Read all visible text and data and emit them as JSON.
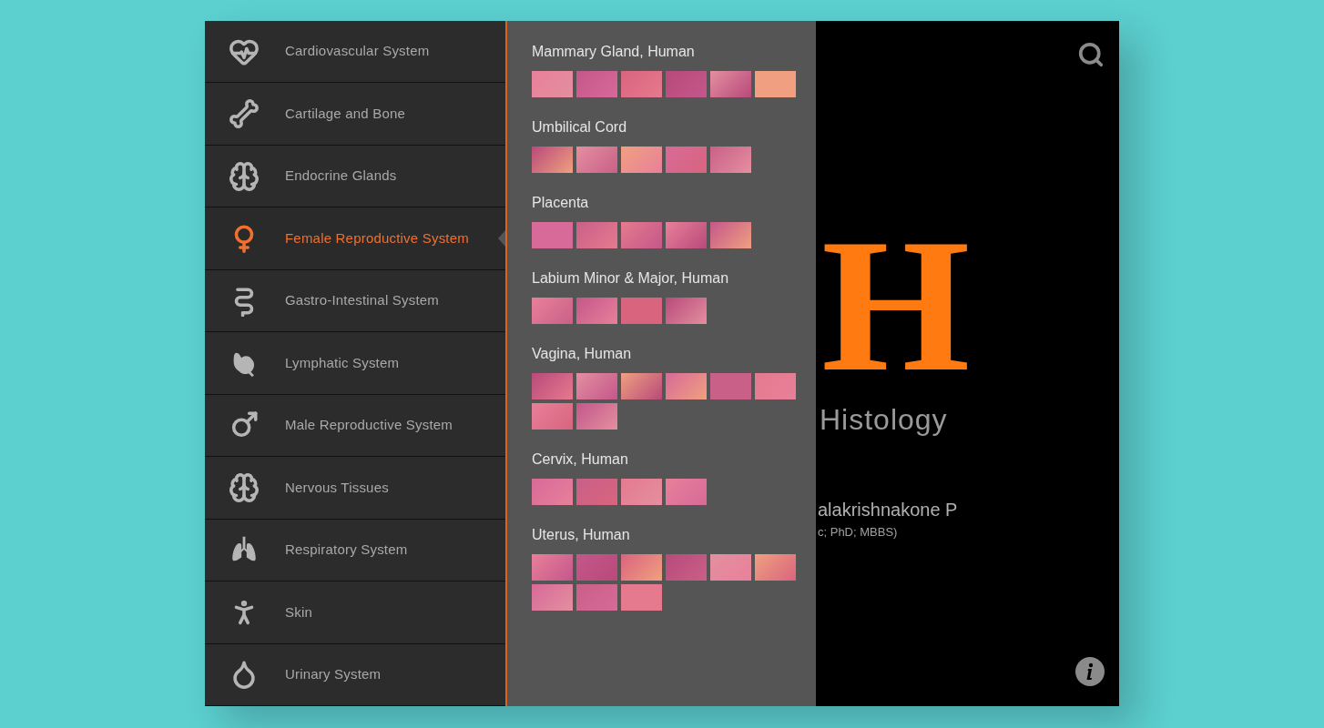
{
  "sidebar": {
    "items": [
      {
        "label": "Cardiovascular System",
        "selected": false
      },
      {
        "label": "Cartilage and Bone",
        "selected": false
      },
      {
        "label": "Endocrine Glands",
        "selected": false
      },
      {
        "label": "Female Reproductive System",
        "selected": true
      },
      {
        "label": "Gastro-Intestinal System",
        "selected": false
      },
      {
        "label": "Lymphatic System",
        "selected": false
      },
      {
        "label": "Male Reproductive System",
        "selected": false
      },
      {
        "label": "Nervous Tissues",
        "selected": false
      },
      {
        "label": "Respiratory System",
        "selected": false
      },
      {
        "label": "Skin",
        "selected": false
      },
      {
        "label": "Urinary System",
        "selected": false
      }
    ]
  },
  "specimens": [
    {
      "title": "Mammary Gland, Human",
      "thumbnails": [
        {
          "kind": "micrograph"
        },
        {
          "kind": "micrograph"
        },
        {
          "kind": "micrograph"
        },
        {
          "kind": "micrograph"
        },
        {
          "kind": "micrograph"
        },
        {
          "kind": "micrograph"
        }
      ]
    },
    {
      "title": "Umbilical Cord",
      "thumbnails": [
        {
          "kind": "micrograph"
        },
        {
          "kind": "micrograph"
        },
        {
          "kind": "micrograph"
        },
        {
          "kind": "micrograph"
        },
        {
          "kind": "micrograph"
        }
      ]
    },
    {
      "title": "Placenta",
      "thumbnails": [
        {
          "kind": "micrograph"
        },
        {
          "kind": "micrograph"
        },
        {
          "kind": "micrograph"
        },
        {
          "kind": "micrograph"
        },
        {
          "kind": "micrograph"
        }
      ]
    },
    {
      "title": "Labium Minor & Major, Human",
      "thumbnails": [
        {
          "kind": "micrograph"
        },
        {
          "kind": "micrograph"
        },
        {
          "kind": "micrograph"
        },
        {
          "kind": "micrograph"
        }
      ]
    },
    {
      "title": "Vagina, Human",
      "thumbnails": [
        {
          "kind": "micrograph"
        },
        {
          "kind": "micrograph"
        },
        {
          "kind": "micrograph"
        },
        {
          "kind": "micrograph"
        },
        {
          "kind": "micrograph"
        },
        {
          "kind": "micrograph"
        },
        {
          "kind": "micrograph"
        },
        {
          "kind": "micrograph"
        }
      ]
    },
    {
      "title": "Cervix, Human",
      "thumbnails": [
        {
          "kind": "micrograph"
        },
        {
          "kind": "micrograph"
        },
        {
          "kind": "micrograph"
        },
        {
          "kind": "micrograph"
        }
      ]
    },
    {
      "title": "Uterus, Human",
      "thumbnails": [
        {
          "kind": "micrograph"
        },
        {
          "kind": "micrograph"
        },
        {
          "kind": "micrograph"
        },
        {
          "kind": "micrograph"
        },
        {
          "kind": "micrograph"
        },
        {
          "kind": "micrograph"
        },
        {
          "kind": "micrograph"
        },
        {
          "kind": "micrograph"
        },
        {
          "kind": "micrograph"
        }
      ]
    }
  ],
  "cover": {
    "logo_letter": "H",
    "title": "Histology",
    "author": "alakrishnakone P",
    "credentials": "c; PhD; MBBS)"
  }
}
